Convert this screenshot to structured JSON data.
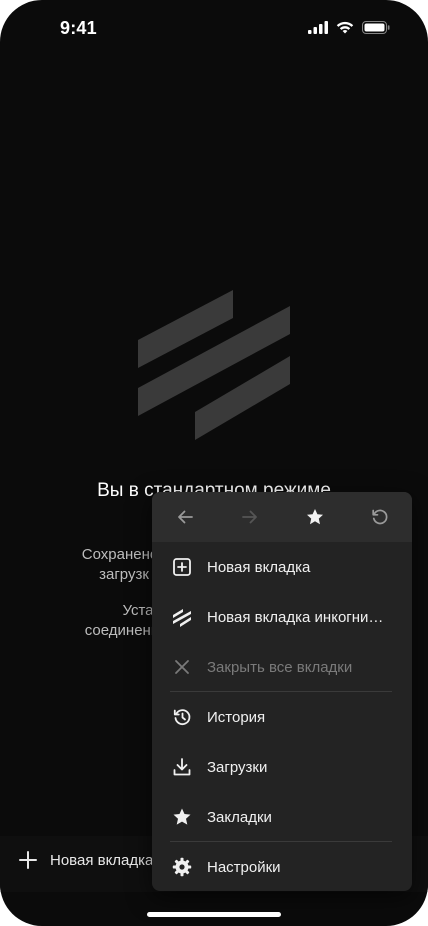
{
  "status_bar": {
    "time": "9:41"
  },
  "main": {
    "title": "Вы в стандартном режиме",
    "line1": "Сохранено",
    "line2": "загрузк",
    "line3": "Уста",
    "line4": "соединени"
  },
  "bottom_bar": {
    "new_tab_label": "Новая вкладка"
  },
  "menu": {
    "toolbar": [
      "back-icon",
      "forward-icon",
      "star-icon",
      "reload-icon"
    ],
    "items": [
      {
        "label": "Новая вкладка",
        "icon": "plus-square-icon"
      },
      {
        "label": "Новая вкладка инкогни…",
        "icon": "incognito-icon"
      },
      {
        "label": "Закрыть все вкладки",
        "icon": "close-icon",
        "disabled": true
      },
      {
        "label": "История",
        "icon": "history-icon"
      },
      {
        "label": "Загрузки",
        "icon": "download-icon"
      },
      {
        "label": "Закладки",
        "icon": "star-icon"
      },
      {
        "label": "Настройки",
        "icon": "gear-icon"
      }
    ]
  },
  "colors": {
    "background": "#0b0b0b",
    "menu": "#232323",
    "menu_toolbar": "#2d2d2d",
    "text": "#f0f0f0",
    "disabled": "#7a7a7a"
  }
}
